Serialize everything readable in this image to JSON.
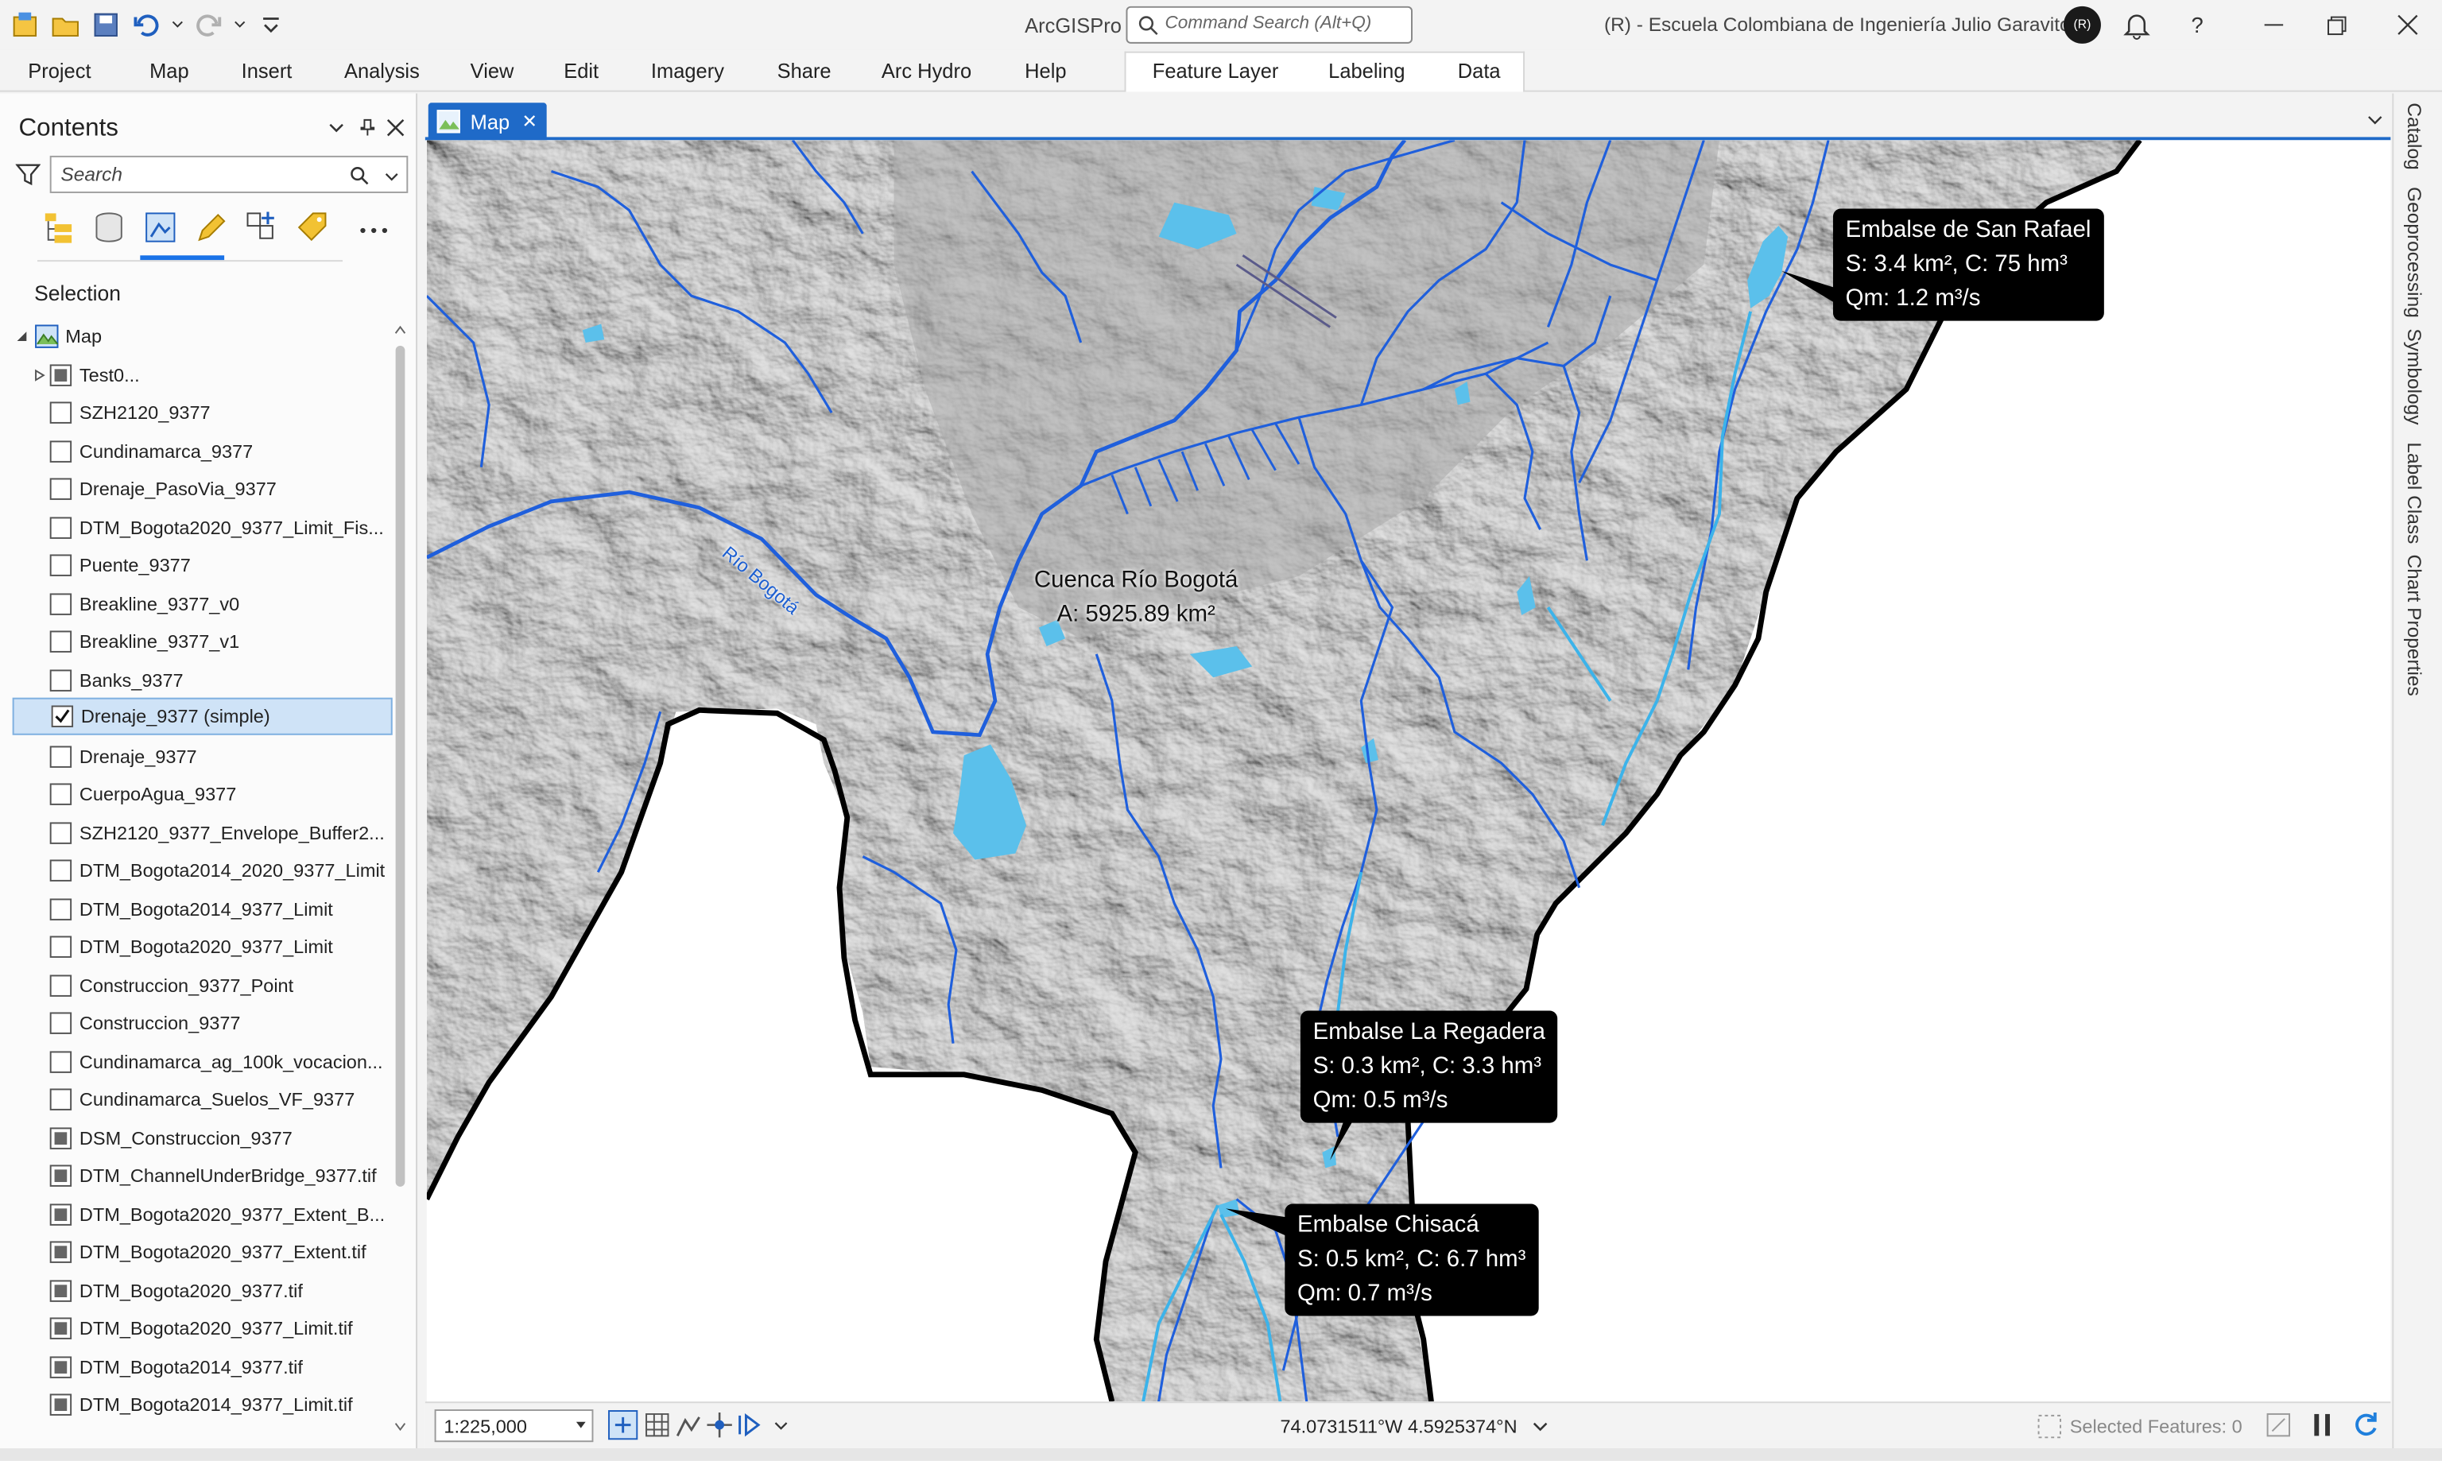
{
  "app": {
    "title": "ArcGISPro",
    "command_search_placeholder": "Command Search (Alt+Q)",
    "organization": "(R) - Escuela Colombiana de Ingeniería Julio Garavito",
    "avatar_initials": "(R)"
  },
  "menu": {
    "items": [
      "Project",
      "Map",
      "Insert",
      "Analysis",
      "View",
      "Edit",
      "Imagery",
      "Share",
      "Arc Hydro",
      "Help"
    ],
    "contextual": [
      "Feature Layer",
      "Labeling",
      "Data"
    ]
  },
  "contents": {
    "title": "Contents",
    "search_placeholder": "Search",
    "section": "Selection",
    "root": "Map",
    "layers": [
      {
        "name": "Test0...",
        "state": "group"
      },
      {
        "name": "SZH2120_9377",
        "state": "off"
      },
      {
        "name": "Cundinamarca_9377",
        "state": "off"
      },
      {
        "name": "Drenaje_PasoVia_9377",
        "state": "off"
      },
      {
        "name": "DTM_Bogota2020_9377_Limit_Fis...",
        "state": "off"
      },
      {
        "name": "Puente_9377",
        "state": "off"
      },
      {
        "name": "Breakline_9377_v0",
        "state": "off"
      },
      {
        "name": "Breakline_9377_v1",
        "state": "off"
      },
      {
        "name": "Banks_9377",
        "state": "off"
      },
      {
        "name": "Drenaje_9377 (simple)",
        "state": "on"
      },
      {
        "name": "Drenaje_9377",
        "state": "off"
      },
      {
        "name": "CuerpoAgua_9377",
        "state": "off"
      },
      {
        "name": "SZH2120_9377_Envelope_Buffer2...",
        "state": "off"
      },
      {
        "name": "DTM_Bogota2014_2020_9377_Limit",
        "state": "off"
      },
      {
        "name": "DTM_Bogota2014_9377_Limit",
        "state": "off"
      },
      {
        "name": "DTM_Bogota2020_9377_Limit",
        "state": "off"
      },
      {
        "name": "Construccion_9377_Point",
        "state": "off"
      },
      {
        "name": "Construccion_9377",
        "state": "off"
      },
      {
        "name": "Cundinamarca_ag_100k_vocacion...",
        "state": "off"
      },
      {
        "name": "Cundinamarca_Suelos_VF_9377",
        "state": "off"
      },
      {
        "name": "DSM_Construccion_9377",
        "state": "raster"
      },
      {
        "name": "DTM_ChannelUnderBridge_9377.tif",
        "state": "raster"
      },
      {
        "name": "DTM_Bogota2020_9377_Extent_B...",
        "state": "raster"
      },
      {
        "name": "DTM_Bogota2020_9377_Extent.tif",
        "state": "raster"
      },
      {
        "name": "DTM_Bogota2020_9377.tif",
        "state": "raster"
      },
      {
        "name": "DTM_Bogota2020_9377_Limit.tif",
        "state": "raster"
      },
      {
        "name": "DTM_Bogota2014_9377.tif",
        "state": "raster"
      },
      {
        "name": "DTM_Bogota2014_9377_Limit.tif",
        "state": "raster"
      }
    ]
  },
  "map": {
    "tab_label": "Map",
    "basin_label": {
      "line1": "Cuenca Río Bogotá",
      "line2": "A: 5925.89 km²"
    },
    "river_label": "Río Bogotá",
    "callouts": [
      {
        "id": "san-rafael",
        "lines": [
          "Embalse de San Rafael",
          "S: 3.4 km², C: 75 hm³",
          "Qm: 1.2 m³/s"
        ]
      },
      {
        "id": "la-regadera",
        "lines": [
          "Embalse La Regadera",
          "S: 0.3 km², C: 3.3 hm³",
          "Qm: 0.5 m³/s"
        ]
      },
      {
        "id": "chisaca",
        "lines": [
          "Embalse Chisacá",
          "S: 0.5 km², C: 6.7 hm³",
          "Qm: 0.7 m³/s"
        ]
      }
    ],
    "colors": {
      "water": "#5bc0eb",
      "drainage": "#1f5fdc",
      "boundary": "#000000",
      "hillshade": "#b8b8b8"
    }
  },
  "status": {
    "scale": "1:225,000",
    "coordinates": "74.0731511°W 4.5925374°N",
    "selected_features": "Selected Features: 0"
  },
  "right_tabs": [
    "Catalog",
    "Geoprocessing",
    "Symbology",
    "Label Class",
    "Chart Properties"
  ]
}
